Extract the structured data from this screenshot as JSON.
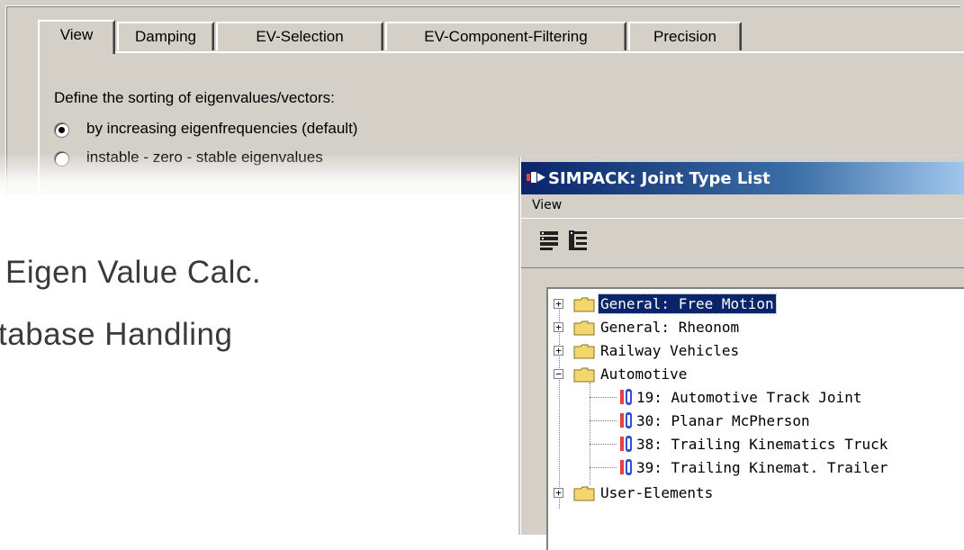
{
  "settings_dialog": {
    "tabs": [
      "View",
      "Damping",
      "EV-Selection",
      "EV-Component-Filtering",
      "Precision"
    ],
    "active_tab": "View",
    "sorting_label": "Define the sorting of eigenvalues/vectors:",
    "options": [
      {
        "label": "by increasing eigenfrequencies (default)",
        "checked": true
      },
      {
        "label": "instable - zero - stable eigenvalues",
        "checked": false
      }
    ]
  },
  "headings": [
    "Eigen Value Calc.",
    "tabase Handling"
  ],
  "joint_window": {
    "title": "SIMPACK: Joint Type List",
    "menu": [
      "View"
    ],
    "toolbar": [
      "expand-tree-icon",
      "collapse-tree-icon"
    ],
    "tree": {
      "groups": [
        {
          "label": "General: Free Motion",
          "expanded": false,
          "selected": true
        },
        {
          "label": "General: Rheonom",
          "expanded": false
        },
        {
          "label": "Railway Vehicles",
          "expanded": false
        },
        {
          "label": "Automotive",
          "expanded": true,
          "children": [
            "19: Automotive Track Joint",
            "30: Planar McPherson",
            "38: Trailing Kinematics Truck",
            "39: Trailing Kinemat. Trailer"
          ]
        },
        {
          "label": "User-Elements",
          "expanded": false
        }
      ]
    }
  },
  "colors": {
    "dialog_bg": "#d4d0c8",
    "titlebar_start": "#0a246a",
    "selection": "#0a246a",
    "folder": "#f4d66e"
  }
}
